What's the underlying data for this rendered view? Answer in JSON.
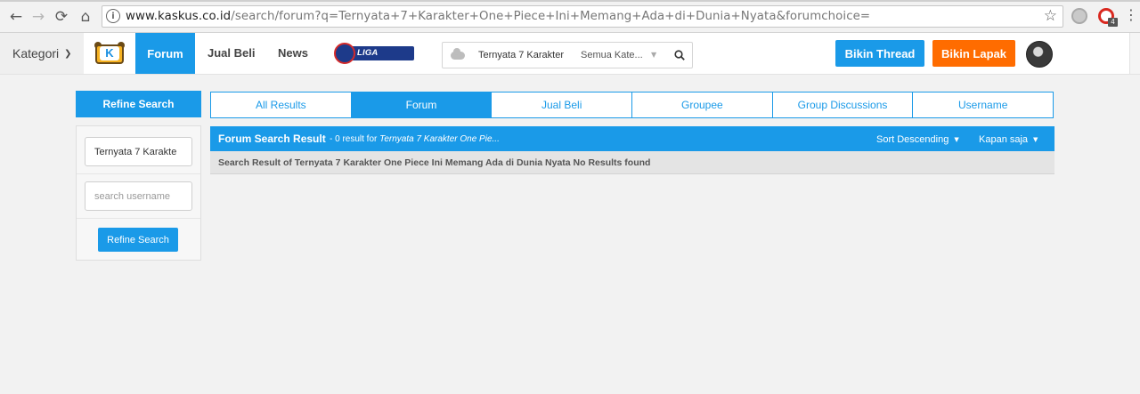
{
  "browser": {
    "back_icon": "arrow-left-icon",
    "forward_icon": "arrow-right-icon",
    "reload_icon": "reload-icon",
    "home_icon": "home-icon",
    "url_host": "www.kaskus.co.id",
    "url_path": "/search/forum?q=Ternyata+7+Karakter+One+Piece+Ini+Memang+Ada+di+Dunia+Nyata&forumchoice=",
    "bookmark_icon": "star-icon",
    "extension_badge": "4"
  },
  "header": {
    "kategori_label": "Kategori",
    "nav": {
      "forum": "Forum",
      "jual_beli": "Jual Beli",
      "news": "News"
    },
    "liga_label": "LIGA INGGRIS",
    "search": {
      "query": "Ternyata 7 Karakter",
      "category": "Semua Kate..."
    },
    "bikin_thread": "Bikin Thread",
    "bikin_lapak": "Bikin Lapak",
    "colors": {
      "primary": "#1a9ae8",
      "orange": "#ff6c00"
    }
  },
  "refine": {
    "title": "Refine Search",
    "keyword_value": "Ternyata 7 Karakte",
    "username_placeholder": "search username",
    "button": "Refine Search"
  },
  "tabs": [
    {
      "label": "All Results",
      "active": false
    },
    {
      "label": "Forum",
      "active": true
    },
    {
      "label": "Jual Beli",
      "active": false
    },
    {
      "label": "Groupee",
      "active": false
    },
    {
      "label": "Group Discussions",
      "active": false
    },
    {
      "label": "Username",
      "active": false
    }
  ],
  "results": {
    "title": "Forum Search Result",
    "count_text": " - 0 result for ",
    "query_italic": "Ternyata 7 Karakter One Pie...",
    "sort_label": "Sort Descending",
    "time_label": "Kapan saja",
    "message": "Search Result of Ternyata 7 Karakter One Piece Ini Memang Ada di Dunia Nyata No Results found"
  }
}
